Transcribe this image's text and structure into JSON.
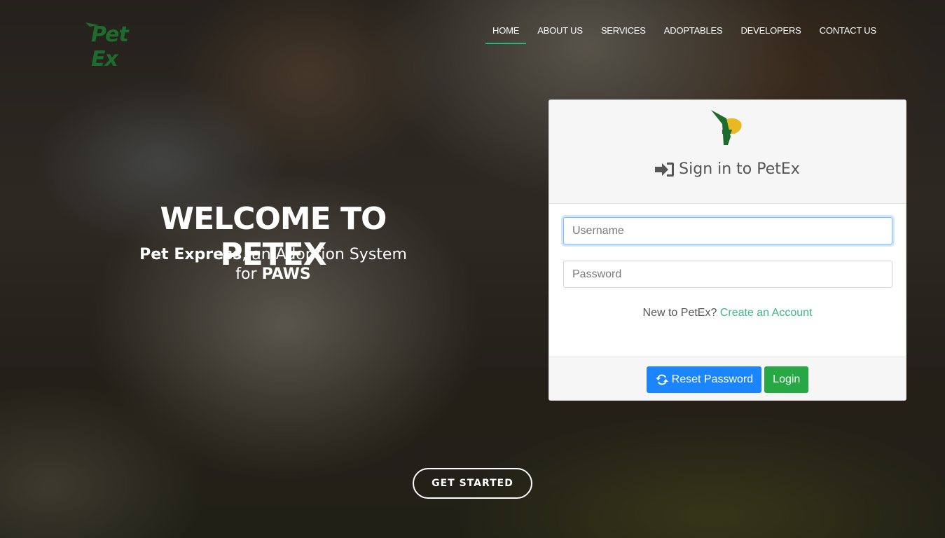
{
  "brand": {
    "logo_text_1": "Pet",
    "logo_text_2": "Ex"
  },
  "nav": {
    "items": [
      {
        "label": "HOME",
        "active": true
      },
      {
        "label": "ABOUT US",
        "active": false
      },
      {
        "label": "SERVICES",
        "active": false
      },
      {
        "label": "ADOPTABLES",
        "active": false
      },
      {
        "label": "DEVELOPERS",
        "active": false
      },
      {
        "label": "CONTACT US",
        "active": false
      }
    ],
    "active_underline_color": "#26b77a"
  },
  "hero": {
    "title": "WELCOME TO PETEX",
    "subtitle_bold_1": "Pet Express",
    "subtitle_text_1": ", an Adoption System",
    "subtitle_text_2": "for ",
    "subtitle_bold_2": "PAWS",
    "cta_label": "GET STARTED"
  },
  "login": {
    "title": "Sign in to PetEx",
    "title_icon": "sign-in-icon",
    "username_placeholder": "Username",
    "username_value": "",
    "password_placeholder": "Password",
    "password_value": "",
    "new_prompt": "New to PetEx?",
    "create_account_label": "Create an Account",
    "reset_label": "Reset Password",
    "reset_icon": "refresh-icon",
    "login_label": "Login"
  },
  "colors": {
    "brand_green": "#1e6b2e",
    "brand_yellow": "#e8b923",
    "link_green": "#3bb889",
    "reset_button": "#1a85ff",
    "login_button": "#28a745"
  }
}
